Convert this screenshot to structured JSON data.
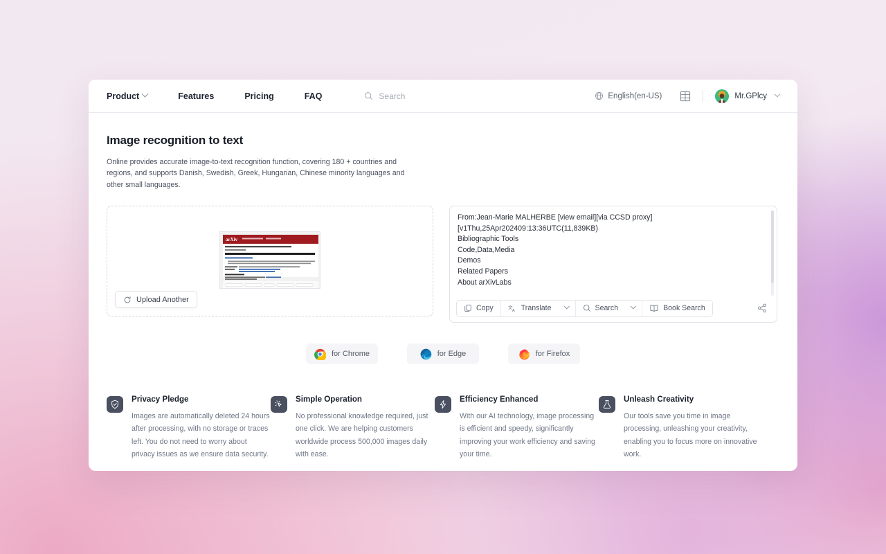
{
  "header": {
    "nav": [
      {
        "label": "Product",
        "has_caret": true
      },
      {
        "label": "Features",
        "has_caret": false
      },
      {
        "label": "Pricing",
        "has_caret": false
      },
      {
        "label": "FAQ",
        "has_caret": false
      }
    ],
    "search_placeholder": "Search",
    "search_icon": "search-icon",
    "language": "English(en-US)",
    "language_icon": "globe-icon",
    "grid_icon": "apps-grid-icon",
    "user_name": "Mr.GPlcy",
    "avatar_icon": "user-avatar"
  },
  "page": {
    "title": "Image recognition to text",
    "description": "Online provides accurate image-to-text recognition function, covering 180 + countries and regions, and supports Danish, Swedish, Greek, Hungarian, Chinese minority languages and other small languages."
  },
  "upload": {
    "button_label": "Upload Another",
    "button_icon": "refresh-icon",
    "thumbnail_alt": "arxiv-abstract-page-thumbnail"
  },
  "result": {
    "lines": [
      "From:Jean-Marie MALHERBE [view email][via CCSD proxy]",
      "[v1Thu,25Apr202409:13:36UTC(11,839KB)",
      "Bibliographic Tools",
      "Code,Data,Media",
      "Demos",
      "Related Papers",
      "About arXivLabs"
    ],
    "toolbar": {
      "copy_label": "Copy",
      "copy_icon": "copy-icon",
      "translate_label": "Translate",
      "translate_icon": "translate-icon",
      "search_label": "Search",
      "search_icon": "search-icon",
      "book_search_label": "Book Search",
      "book_search_icon": "book-icon",
      "share_icon": "share-icon"
    }
  },
  "browsers": [
    {
      "label": "for Chrome",
      "icon": "chrome-icon"
    },
    {
      "label": "for Edge",
      "icon": "edge-icon"
    },
    {
      "label": "for Firefox",
      "icon": "firefox-icon"
    }
  ],
  "features": [
    {
      "icon": "shield-check-icon",
      "title": "Privacy Pledge",
      "desc": "Images are automatically deleted 24 hours after processing, with no storage or traces left. You do not need to worry about privacy issues as we ensure data security."
    },
    {
      "icon": "click-cursor-icon",
      "title": "Simple Operation",
      "desc": "No professional knowledge required, just one click. We are helping customers worldwide process 500,000 images daily with ease."
    },
    {
      "icon": "lightning-bolt-icon",
      "title": "Efficiency Enhanced",
      "desc": "With our AI technology, image processing is efficient and speedy, significantly improving your work efficiency and saving your time."
    },
    {
      "icon": "flask-icon",
      "title": "Unleash Creativity",
      "desc": "Our tools save you time in image processing, unleashing your creativity, enabling you to focus more on innovative work."
    }
  ],
  "colors": {
    "accent_dark": "#4a5060",
    "page_bg": "#ffffff",
    "text_primary": "#1b212c",
    "text_muted": "#6f7686",
    "arxiv_red": "#a01b20"
  }
}
